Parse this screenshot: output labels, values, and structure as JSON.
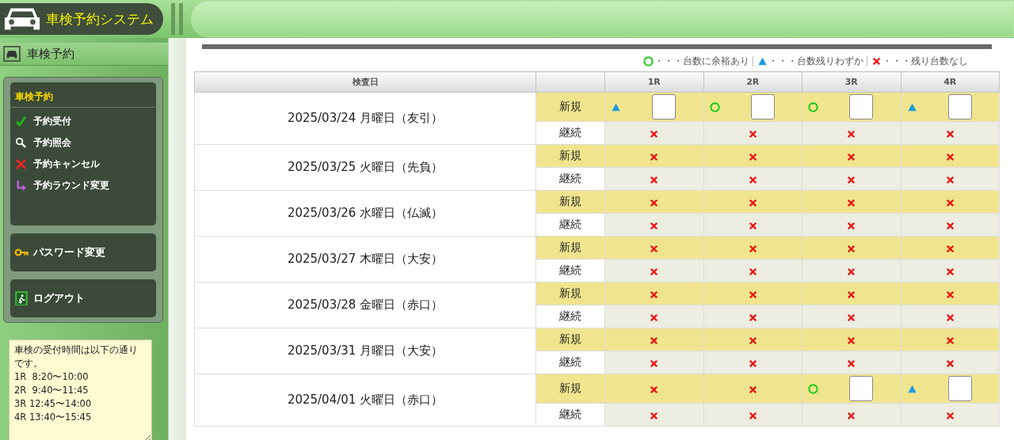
{
  "header": {
    "title": "車検予約システム"
  },
  "sidebar": {
    "tab": "車検予約",
    "menu_title": "車検予約",
    "menu_items": [
      {
        "kind": "check",
        "label": "予約受付"
      },
      {
        "kind": "search",
        "label": "予約照会"
      },
      {
        "kind": "cancel",
        "label": "予約キャンセル"
      },
      {
        "kind": "change",
        "label": "予約ラウンド変更"
      }
    ],
    "buttons": [
      {
        "kind": "key",
        "label": "パスワード変更"
      },
      {
        "kind": "exit",
        "label": "ログアウト"
      }
    ],
    "notice": [
      "車検の受付時間は以下の通りです。",
      "1R  8:20〜10:00",
      "2R  9:40〜11:45",
      "3R 12:45〜14:00",
      "4R 13:40〜15:45"
    ]
  },
  "legend": [
    {
      "kind": "ok",
      "text": "・・・台数に余裕あり"
    },
    {
      "kind": "few",
      "text": "・・・台数残りわずか"
    },
    {
      "kind": "none",
      "text": "・・・残り台数なし"
    }
  ],
  "table": {
    "columns": [
      "検査日",
      "1R",
      "2R",
      "3R",
      "4R"
    ],
    "days": [
      {
        "date": "2025/03/24 月曜日（友引）",
        "rows": [
          {
            "type": "新規",
            "slots": [
              {
                "kind": "few"
              },
              {
                "kind": "ok"
              },
              {
                "kind": "ok"
              },
              {
                "kind": "few"
              }
            ]
          },
          {
            "type": "継続",
            "slots": [
              {
                "kind": "none"
              },
              {
                "kind": "none"
              },
              {
                "kind": "none"
              },
              {
                "kind": "none"
              }
            ]
          }
        ]
      },
      {
        "date": "2025/03/25 火曜日（先負）",
        "rows": [
          {
            "type": "新規",
            "slots": [
              {
                "kind": "none"
              },
              {
                "kind": "none"
              },
              {
                "kind": "none"
              },
              {
                "kind": "none"
              }
            ]
          },
          {
            "type": "継続",
            "slots": [
              {
                "kind": "none"
              },
              {
                "kind": "none"
              },
              {
                "kind": "none"
              },
              {
                "kind": "none"
              }
            ]
          }
        ]
      },
      {
        "date": "2025/03/26 水曜日（仏滅）",
        "rows": [
          {
            "type": "新規",
            "slots": [
              {
                "kind": "none"
              },
              {
                "kind": "none"
              },
              {
                "kind": "none"
              },
              {
                "kind": "none"
              }
            ]
          },
          {
            "type": "継続",
            "slots": [
              {
                "kind": "none"
              },
              {
                "kind": "none"
              },
              {
                "kind": "none"
              },
              {
                "kind": "none"
              }
            ]
          }
        ]
      },
      {
        "date": "2025/03/27 木曜日（大安）",
        "rows": [
          {
            "type": "新規",
            "slots": [
              {
                "kind": "none"
              },
              {
                "kind": "none"
              },
              {
                "kind": "none"
              },
              {
                "kind": "none"
              }
            ]
          },
          {
            "type": "継続",
            "slots": [
              {
                "kind": "none"
              },
              {
                "kind": "none"
              },
              {
                "kind": "none"
              },
              {
                "kind": "none"
              }
            ]
          }
        ]
      },
      {
        "date": "2025/03/28 金曜日（赤口）",
        "rows": [
          {
            "type": "新規",
            "slots": [
              {
                "kind": "none"
              },
              {
                "kind": "none"
              },
              {
                "kind": "none"
              },
              {
                "kind": "none"
              }
            ]
          },
          {
            "type": "継続",
            "slots": [
              {
                "kind": "none"
              },
              {
                "kind": "none"
              },
              {
                "kind": "none"
              },
              {
                "kind": "none"
              }
            ]
          }
        ]
      },
      {
        "date": "2025/03/31 月曜日（大安）",
        "rows": [
          {
            "type": "新規",
            "slots": [
              {
                "kind": "none"
              },
              {
                "kind": "none"
              },
              {
                "kind": "none"
              },
              {
                "kind": "none"
              }
            ]
          },
          {
            "type": "継続",
            "slots": [
              {
                "kind": "none"
              },
              {
                "kind": "none"
              },
              {
                "kind": "none"
              },
              {
                "kind": "none"
              }
            ]
          }
        ]
      },
      {
        "date": "2025/04/01 火曜日（赤口）",
        "rows": [
          {
            "type": "新規",
            "slots": [
              {
                "kind": "none"
              },
              {
                "kind": "none"
              },
              {
                "kind": "ok"
              },
              {
                "kind": "few"
              }
            ]
          },
          {
            "type": "継続",
            "slots": [
              {
                "kind": "none"
              },
              {
                "kind": "none"
              },
              {
                "kind": "none"
              },
              {
                "kind": "none"
              }
            ]
          }
        ]
      }
    ]
  }
}
